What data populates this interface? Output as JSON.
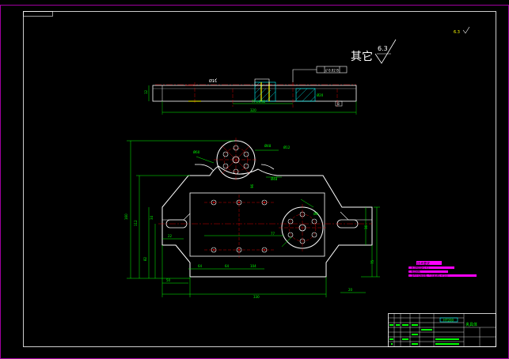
{
  "colors": {
    "background": "#000000",
    "frame": "#a000a0",
    "outline": "#ffffff",
    "dimension": "#00ff00",
    "holes": "#ffff00",
    "centerline": "#ff0000",
    "magenta": "#ff00ff",
    "cyan": "#00ffff"
  },
  "corner_label": "",
  "surface_note": {
    "chinese": "其它",
    "roughness": "6.3"
  },
  "top_right_mark": "6.3",
  "side_view": {
    "tolerance_frame": "// 0.02 B",
    "center_dim": "77±0.02",
    "length_dim": "320",
    "thickness_dim": "12",
    "hole_label": "Ø11",
    "datum": "B"
  },
  "plan_view": {
    "height_total": "160",
    "height_body": "112",
    "height_slot": "82",
    "height_lower": "34",
    "width_total": "330",
    "width_bottom": "270",
    "offset_left": "50",
    "bore_spacing_1": "64",
    "bore_spacing_2": "64",
    "bore_spacing_3": "104",
    "slot_width": "22",
    "bore_dia_top": "Ø60",
    "bolt_circle_top": "Ø48",
    "hole_top": "Ø12",
    "bore_dia_right": "Ø48",
    "hole_right": "Ø8",
    "dim_96": "96",
    "dim_77": "77",
    "dim_36": "36",
    "dim_75": "75",
    "dim_20": "20"
  },
  "legend_text": [
    "技术要求",
    "1. 未注明圆角R2-R3",
    "2. 锐边倒钝",
    "3. 铸件不得有砂眼、气孔等缺陷 HT200"
  ],
  "title_block": {
    "name": "夹具体",
    "material": "HT200"
  }
}
